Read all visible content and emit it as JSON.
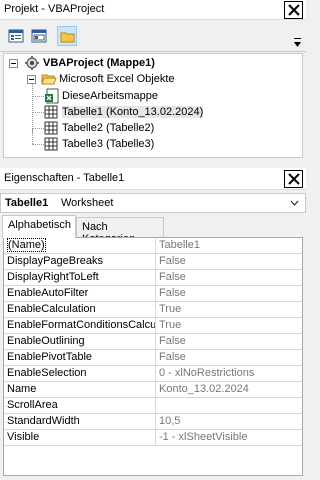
{
  "project_pane": {
    "title": "Projekt - VBAProject",
    "tree": [
      {
        "label": "VBAProject (Mappe1)",
        "bold": true
      },
      {
        "label": "Microsoft Excel Objekte"
      },
      {
        "label": "DieseArbeitsmappe"
      },
      {
        "label": "Tabelle1 (Konto_13.02.2024)"
      },
      {
        "label": "Tabelle2 (Tabelle2)"
      },
      {
        "label": "Tabelle3 (Tabelle3)"
      }
    ]
  },
  "properties_pane": {
    "title": "Eigenschaften - Tabelle1",
    "object_name": "Tabelle1",
    "object_type": "Worksheet",
    "tabs": [
      "Alphabetisch",
      "Nach Kategorien"
    ],
    "rows": [
      {
        "key": "(Name)",
        "value": "Tabelle1"
      },
      {
        "key": "DisplayPageBreaks",
        "value": "False"
      },
      {
        "key": "DisplayRightToLeft",
        "value": "False"
      },
      {
        "key": "EnableAutoFilter",
        "value": "False"
      },
      {
        "key": "EnableCalculation",
        "value": "True"
      },
      {
        "key": "EnableFormatConditionsCalculation",
        "value": "True"
      },
      {
        "key": "EnableOutlining",
        "value": "False"
      },
      {
        "key": "EnablePivotTable",
        "value": "False"
      },
      {
        "key": "EnableSelection",
        "value": "0 - xlNoRestrictions"
      },
      {
        "key": "Name",
        "value": "Konto_13.02.2024"
      },
      {
        "key": "ScrollArea",
        "value": ""
      },
      {
        "key": "StandardWidth",
        "value": "10,5"
      },
      {
        "key": "Visible",
        "value": "-1 - xlSheetVisible"
      }
    ]
  }
}
